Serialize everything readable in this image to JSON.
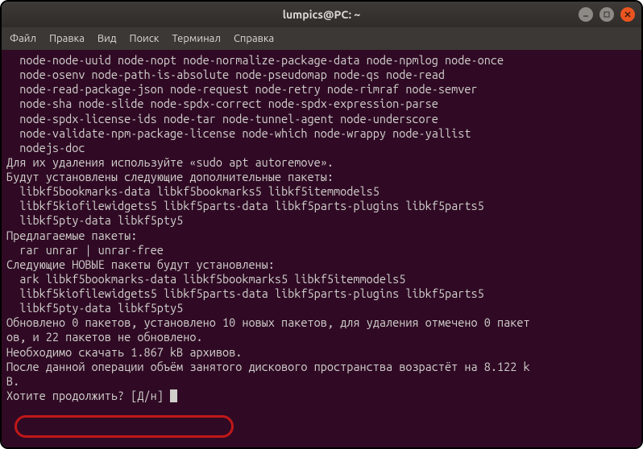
{
  "window": {
    "title": "lumpics@PC: ~"
  },
  "menu": {
    "file": "Файл",
    "edit": "Правка",
    "view": "Вид",
    "search": "Поиск",
    "terminal": "Терминал",
    "help": "Справка"
  },
  "terminal": {
    "l1": "  node-node-uuid node-nopt node-normalize-package-data node-npmlog node-once",
    "l2": "  node-osenv node-path-is-absolute node-pseudomap node-qs node-read",
    "l3": "  node-read-package-json node-request node-retry node-rimraf node-semver",
    "l4": "  node-sha node-slide node-spdx-correct node-spdx-expression-parse",
    "l5": "  node-spdx-license-ids node-tar node-tunnel-agent node-underscore",
    "l6": "  node-validate-npm-package-license node-which node-wrappy node-yallist",
    "l7": "  nodejs-doc",
    "l8": "Для их удаления используйте «sudo apt autoremove».",
    "l9": "Будут установлены следующие дополнительные пакеты:",
    "l10": "  libkf5bookmarks-data libkf5bookmarks5 libkf5itemmodels5",
    "l11": "  libkf5kiofilewidgets5 libkf5parts-data libkf5parts-plugins libkf5parts5",
    "l12": "  libkf5pty-data libkf5pty5",
    "l13": "Предлагаемые пакеты:",
    "l14": "  rar unrar | unrar-free",
    "l15": "Следующие НОВЫЕ пакеты будут установлены:",
    "l16": "  ark libkf5bookmarks-data libkf5bookmarks5 libkf5itemmodels5",
    "l17": "  libkf5kiofilewidgets5 libkf5parts-data libkf5parts-plugins libkf5parts5",
    "l18": "  libkf5pty-data libkf5pty5",
    "l19": "Обновлено 0 пакетов, установлено 10 новых пакетов, для удаления отмечено 0 пакет",
    "l20": "ов, и 22 пакетов не обновлено.",
    "l21": "Необходимо скачать 1.867 kB архивов.",
    "l22": "После данной операции объём занятого дискового пространства возрастёт на 8.122 k",
    "l23": "B.",
    "l24": "Хотите продолжить? [Д/н] "
  }
}
